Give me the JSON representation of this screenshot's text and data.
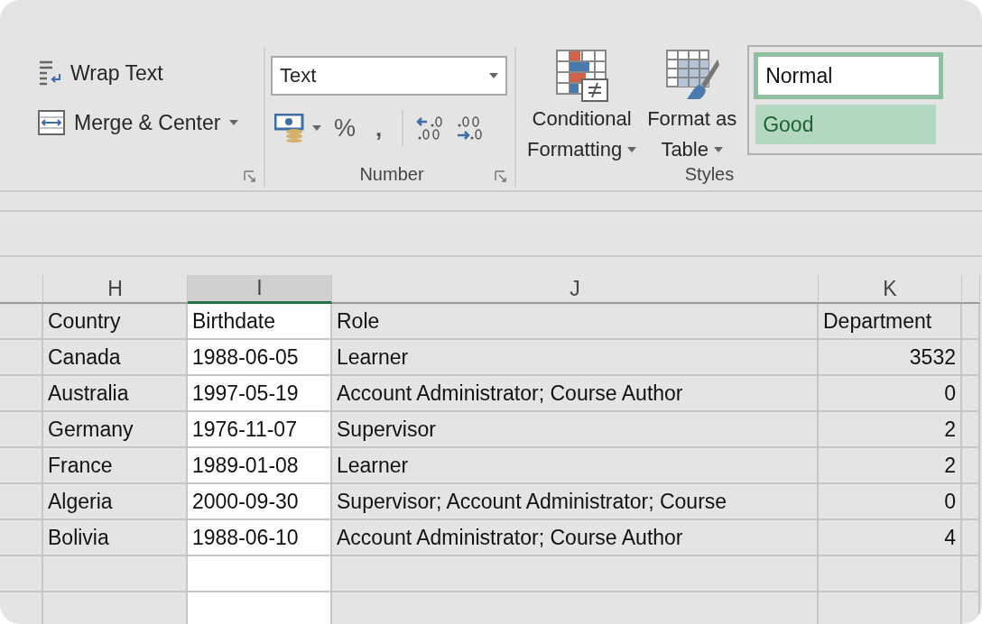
{
  "ribbon": {
    "alignment": {
      "wrap_text": "Wrap Text",
      "merge_center": "Merge & Center"
    },
    "number": {
      "format": "Text",
      "percent": "%",
      "comma": ",",
      "label": "Number"
    },
    "styles": {
      "conditional_formatting": [
        "Conditional",
        "Formatting"
      ],
      "format_as_table": [
        "Format as",
        "Table"
      ],
      "cell_styles": [
        {
          "name": "Normal",
          "kind": "normal",
          "selected": true
        },
        {
          "name": "Good",
          "kind": "good",
          "selected": false
        }
      ],
      "label": "Styles"
    }
  },
  "sheet": {
    "columns": [
      {
        "letter": "H",
        "selected": false
      },
      {
        "letter": "I",
        "selected": true
      },
      {
        "letter": "J",
        "selected": false
      },
      {
        "letter": "K",
        "selected": false
      }
    ],
    "rows": [
      [
        "Country",
        "Birthdate",
        "Role",
        "Department"
      ],
      [
        "Canada",
        "1988-06-05",
        "Learner",
        "3532"
      ],
      [
        "Australia",
        "1997-05-19",
        "Account Administrator; Course Author",
        "0"
      ],
      [
        "Germany",
        "1976-11-07",
        "Supervisor",
        "2"
      ],
      [
        "France",
        "1989-01-08",
        "Learner",
        "2"
      ],
      [
        "Algeria",
        "2000-09-30",
        "Supervisor; Account Administrator; Course",
        "0"
      ],
      [
        "Bolivia",
        "1988-06-10",
        "Account Administrator; Course Author",
        "4"
      ]
    ]
  }
}
